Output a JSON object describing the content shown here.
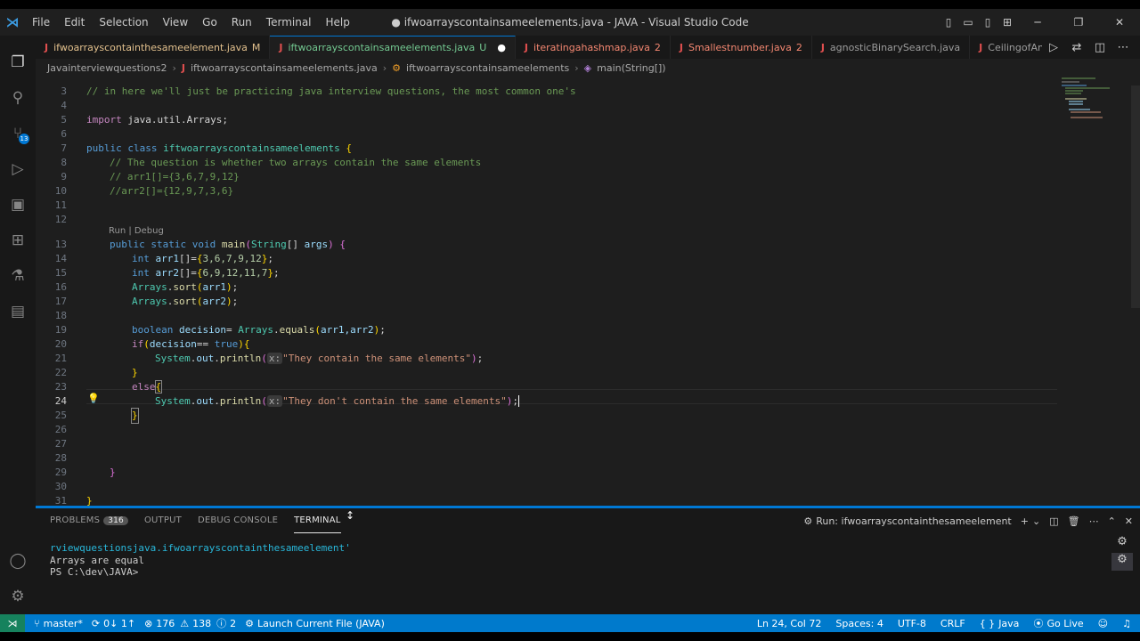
{
  "window": {
    "title": "● ifwoarrayscontainsameelements.java - JAVA - Visual Studio Code",
    "menu": [
      "File",
      "Edit",
      "Selection",
      "View",
      "Go",
      "Run",
      "Terminal",
      "Help"
    ]
  },
  "activity_bar": {
    "source_control_badge": "13"
  },
  "tabs": [
    {
      "name": "ifwoarrayscontainthesameelement.java",
      "status": "M"
    },
    {
      "name": "iftwoarrayscontainsameelements.java",
      "status": "U",
      "dirty": "●"
    },
    {
      "name": "iteratingahashmap.java",
      "status": "2"
    },
    {
      "name": "Smallestnumber.java",
      "status": "2"
    },
    {
      "name": "agnosticBinarySearch.java",
      "status": ""
    },
    {
      "name": "CeilingofAnumber.java",
      "status": ""
    }
  ],
  "breadcrumb": {
    "folder": "Javainterviewquestions2",
    "file": "iftwoarrayscontainsameelements.java",
    "class": "iftwoarrayscontainsameelements",
    "method": "main(String[])"
  },
  "editor": {
    "codelens": "Run | Debug",
    "param_hint": "x:",
    "lines": {
      "l3": "// in here we'll just be practicing java interview questions, the most common one's",
      "l5_kw": "import",
      "l5_rest": " java.util.Arrays;",
      "l7_kw": "public class",
      "l7_name": "iftwoarrayscontainsameelements",
      "l8": "// The question is whether two arrays contain the same elements",
      "l9": "// arr1[]={3,6,7,9,12}",
      "l10": "//arr2[]={12,9,7,3,6}",
      "l13_kw": "public static void",
      "l13_fn": "main",
      "l13_ty": "String",
      "l13_args": "args",
      "l14_kw": "int",
      "l14_var": "arr1",
      "l14_vals": "3,6,7,9,12",
      "l15_kw": "int",
      "l15_var": "arr2",
      "l15_vals": "6,9,12,11,7",
      "l16_cls": "Arrays",
      "l16_fn": "sort",
      "l16_arg": "arr1",
      "l17_cls": "Arrays",
      "l17_fn": "sort",
      "l17_arg": "arr2",
      "l19_kw": "boolean",
      "l19_var": "decision",
      "l19_cls": "Arrays",
      "l19_fn": "equals",
      "l19_args": "arr1,arr2",
      "l20_kw": "if",
      "l20_var": "decision",
      "l20_val": "true",
      "l21_obj": "System",
      "l21_out": "out",
      "l21_fn": "println",
      "l21_str": "\"They contain the same elements\"",
      "l23_kw": "else",
      "l24_obj": "System",
      "l24_out": "out",
      "l24_fn": "println",
      "l24_str": "\"They don't contain the same elements\""
    }
  },
  "panel": {
    "tabs": [
      "PROBLEMS",
      "OUTPUT",
      "DEBUG CONSOLE",
      "TERMINAL"
    ],
    "problems_count": "316",
    "run_label": "Run: ifwoarrayscontainthesameelement",
    "terminal_lines": [
      "rviewquestionsjava.ifwoarrayscontainthesameelement'",
      "Arrays are equal",
      "PS C:\\dev\\JAVA>"
    ]
  },
  "status_bar": {
    "branch": "master*",
    "sync": "0↓ 1↑",
    "errors": "176",
    "warnings": "138",
    "info": "2",
    "launch": "Launch Current File (JAVA)",
    "position": "Ln 24, Col 72",
    "spaces": "Spaces: 4",
    "encoding": "UTF-8",
    "eol": "CRLF",
    "language": "Java",
    "golive": "Go Live"
  },
  "colors": {
    "accent": "#0078d4",
    "status_bar": "#007acc",
    "editor_bg": "#1e1e1e"
  }
}
